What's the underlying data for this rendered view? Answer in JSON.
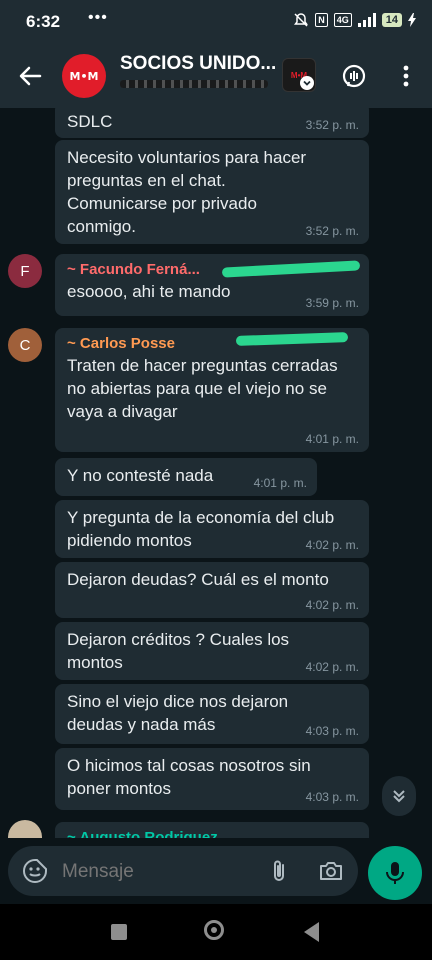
{
  "status_bar": {
    "time": "6:32",
    "dots": "•••",
    "network": "4G",
    "battery": "14"
  },
  "header": {
    "group_initials": "M•M",
    "title": "SOCIOS UNIDO...",
    "thumb_initials": "M•M"
  },
  "messages": [
    {
      "text": "SDLC",
      "time": "3:52 p. m."
    },
    {
      "text": "Necesito voluntarios para hacer preguntas en el chat. Comunicarse por privado conmigo.",
      "time": "3:52 p. m."
    },
    {
      "avatar_letter": "F",
      "avatar_color": "#8b2b3f",
      "sender": "~ Facundo Ferná...",
      "sender_color": "#ff6b6b",
      "text": "esoooo, ahi te mando",
      "time": "3:59 p. m."
    },
    {
      "avatar_letter": "C",
      "avatar_color": "#a0603a",
      "sender": "~ Carlos Posse",
      "sender_color": "#ff9a52",
      "text": "Traten de hacer preguntas cerradas no abiertas para que el viejo no se vaya a divagar",
      "time": "4:01 p. m."
    },
    {
      "text": "Y no contesté nada",
      "time": "4:01 p. m."
    },
    {
      "text": "Y pregunta de la economía del club pidiendo montos",
      "time": "4:02 p. m."
    },
    {
      "text": "Dejaron deudas? Cuál es el monto",
      "time": "4:02 p. m."
    },
    {
      "text": "Dejaron créditos ? Cuales los montos",
      "time": "4:02 p. m."
    },
    {
      "text": "Sino el viejo dice nos dejaron deudas y nada más",
      "time": "4:03 p. m."
    },
    {
      "text": "O hicimos tal cosas nosotros sin poner montos",
      "time": "4:03 p. m."
    }
  ],
  "next_sender": {
    "sender": "~ Augusto Rodriguez",
    "sender_color": "#00c9a7"
  },
  "input": {
    "placeholder": "Mensaje"
  },
  "colors": {
    "accent": "#00a884",
    "bubble": "#1f2c33",
    "background": "#0b1418"
  }
}
